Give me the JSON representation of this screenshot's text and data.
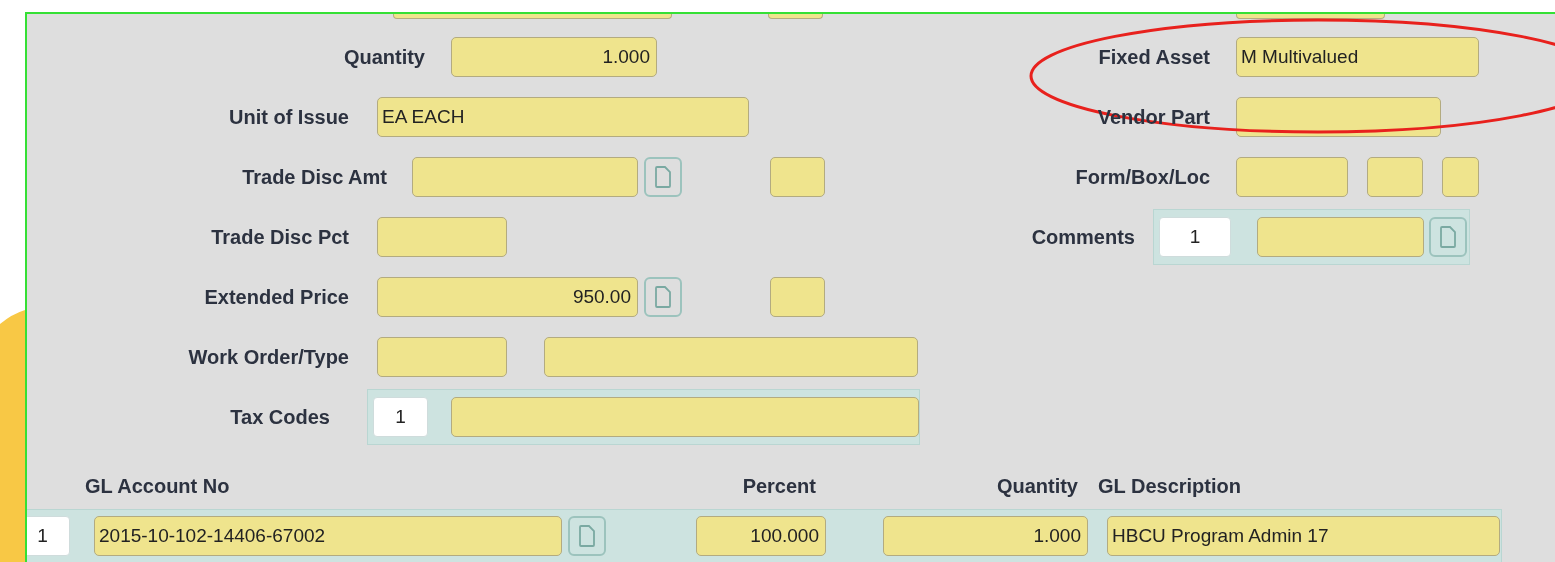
{
  "form": {
    "left_rows": [
      {
        "label": "Quantity",
        "items": [
          {
            "kind": "number",
            "value": "1.000"
          }
        ]
      },
      {
        "label": "Unit of Issue",
        "items": [
          {
            "kind": "text",
            "value": "EA EACH"
          }
        ]
      },
      {
        "label": "Trade Disc Amt",
        "items": [
          {
            "kind": "text"
          },
          {
            "kind": "lookup"
          },
          {
            "kind": "text"
          }
        ]
      },
      {
        "label": "Trade Disc Pct",
        "items": [
          {
            "kind": "text"
          }
        ]
      },
      {
        "label": "Extended Price",
        "items": [
          {
            "kind": "number",
            "value": "950.00"
          },
          {
            "kind": "lookup"
          },
          {
            "kind": "text"
          }
        ]
      },
      {
        "label": "Work Order/Type",
        "items": [
          {
            "kind": "text"
          },
          {
            "kind": "text"
          }
        ]
      },
      {
        "label": "Tax Codes",
        "items": [
          {
            "kind": "group",
            "items": [
              {
                "kind": "index",
                "value": "1"
              },
              {
                "kind": "text"
              }
            ]
          }
        ]
      }
    ],
    "right_rows": [
      {
        "label": "Fixed Asset",
        "items": [
          {
            "kind": "text",
            "value": "M Multivalued"
          }
        ]
      },
      {
        "label": "Vendor Part",
        "items": [
          {
            "kind": "text"
          }
        ]
      },
      {
        "label": "Form/Box/Loc",
        "items": [
          {
            "kind": "text"
          },
          {
            "kind": "text"
          },
          {
            "kind": "text"
          }
        ]
      },
      {
        "label": "Comments",
        "items": [
          {
            "kind": "group",
            "items": [
              {
                "kind": "index",
                "value": "1"
              },
              {
                "kind": "text"
              },
              {
                "kind": "lookup"
              }
            ]
          }
        ]
      }
    ]
  },
  "gl_table": {
    "columns": [
      "GL Account No",
      "Percent",
      "Quantity",
      "GL Description"
    ],
    "rows": [
      {
        "line": "1",
        "account": "2015-10-102-14406-67002",
        "percent": "100.000",
        "quantity": "1.000",
        "description": "HBCU Program Admin 17"
      }
    ]
  },
  "annotation": {
    "kind": "ellipse"
  }
}
